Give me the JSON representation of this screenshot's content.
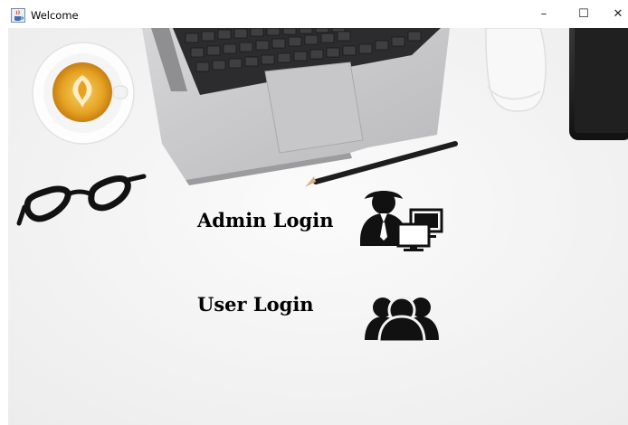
{
  "window": {
    "title": "Welcome",
    "controls": {
      "minimize": "–",
      "maximize": "☐",
      "close": "✕"
    }
  },
  "menu": {
    "admin_login": "Admin Login",
    "user_login": "User Login"
  },
  "icons": {
    "app": "java-coffee-icon",
    "admin": "admin-computer-icon",
    "user": "users-group-icon"
  }
}
